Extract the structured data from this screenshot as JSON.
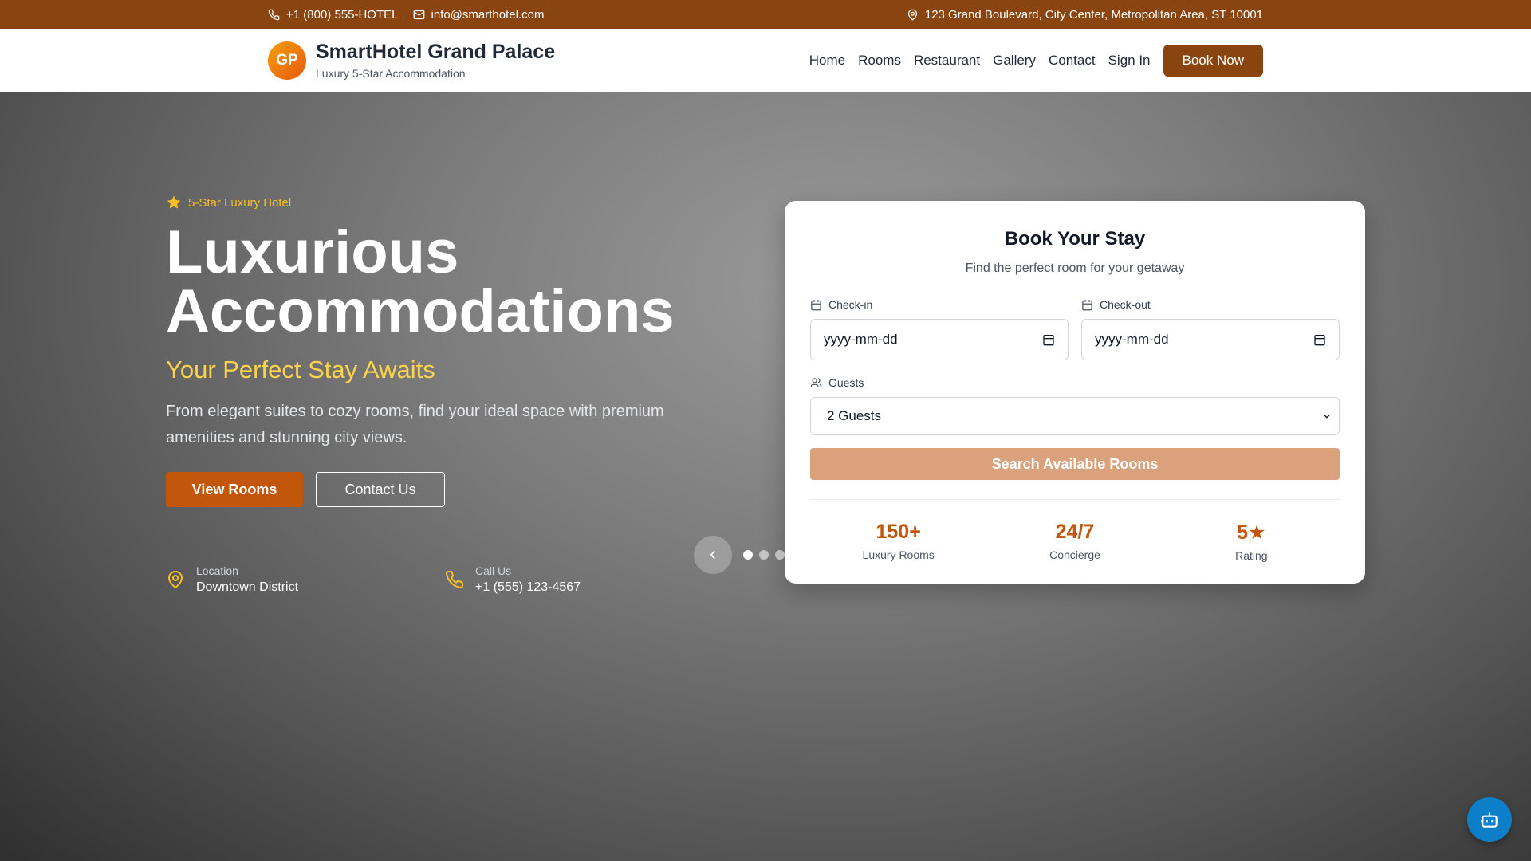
{
  "topbar": {
    "phone": "+1 (800) 555-HOTEL",
    "email": "info@smarthotel.com",
    "address": "123 Grand Boulevard, City Center, Metropolitan Area, ST 10001"
  },
  "header": {
    "logo_initials": "GP",
    "brand_name": "SmartHotel Grand Palace",
    "brand_tagline": "Luxury 5-Star Accommodation",
    "nav": [
      "Home",
      "Rooms",
      "Restaurant",
      "Gallery",
      "Contact",
      "Sign In"
    ],
    "book_now": "Book Now"
  },
  "hero": {
    "badge": "5-Star Luxury Hotel",
    "title_line1": "Luxurious",
    "title_line2": "Accommodations",
    "subtitle": "Your Perfect Stay Awaits",
    "description": "From elegant suites to cozy rooms, find your ideal space with premium amenities and stunning city views.",
    "view_rooms": "View Rooms",
    "contact_us": "Contact Us",
    "info": [
      {
        "label": "Location",
        "value": "Downtown District",
        "icon": "map-pin-icon"
      },
      {
        "label": "Call Us",
        "value": "+1 (555) 123-4567",
        "icon": "phone-icon"
      }
    ]
  },
  "booking": {
    "title": "Book Your Stay",
    "subtitle": "Find the perfect room for your getaway",
    "checkin_label": "Check-in",
    "checkin_placeholder": "yyyy-mm-dd",
    "checkout_label": "Check-out",
    "checkout_placeholder": "yyyy-mm-dd",
    "guests_label": "Guests",
    "guests_value": "2 Guests",
    "search_button": "Search Available Rooms",
    "stats": [
      {
        "value": "150+",
        "label": "Luxury Rooms"
      },
      {
        "value": "24/7",
        "label": "Concierge"
      },
      {
        "value": "5★",
        "label": "Rating"
      }
    ]
  },
  "carousel": {
    "slides": 3,
    "active": 0
  },
  "colors": {
    "brand": "#8a4410",
    "accent": "#c2570c",
    "gold": "#fbbf24",
    "search_button": "#d9a27c",
    "chatbot": "#0d7fc8"
  }
}
